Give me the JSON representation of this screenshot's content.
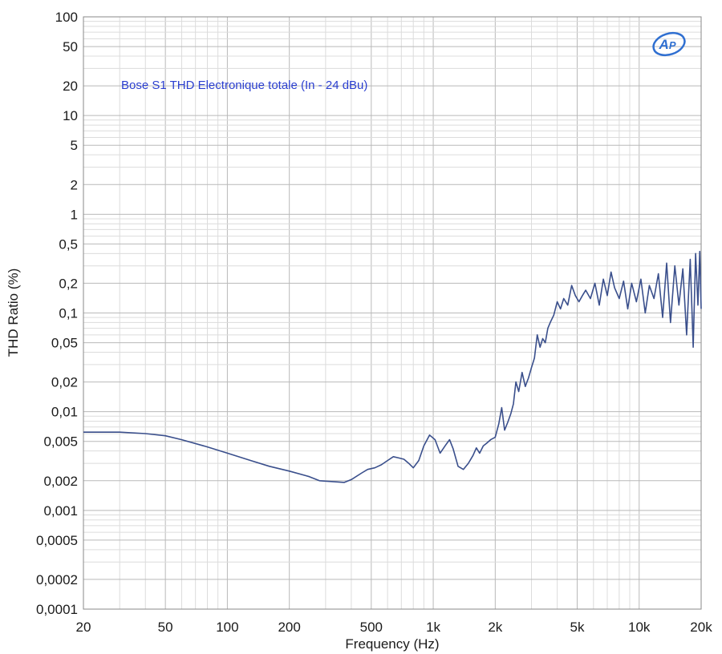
{
  "chart_data": {
    "type": "line",
    "annotation": "Bose S1 THD Electronique totale (In - 24 dBu)",
    "xlabel": "Frequency (Hz)",
    "ylabel": "THD Ratio (%)",
    "xscale": "log",
    "yscale": "log",
    "xlim": [
      20,
      20000
    ],
    "ylim": [
      0.0001,
      100
    ],
    "grid": true,
    "x_ticks": [
      {
        "value": 20,
        "label": "20"
      },
      {
        "value": 50,
        "label": "50"
      },
      {
        "value": 100,
        "label": "100"
      },
      {
        "value": 200,
        "label": "200"
      },
      {
        "value": 500,
        "label": "500"
      },
      {
        "value": 1000,
        "label": "1k"
      },
      {
        "value": 2000,
        "label": "2k"
      },
      {
        "value": 5000,
        "label": "5k"
      },
      {
        "value": 10000,
        "label": "10k"
      },
      {
        "value": 20000,
        "label": "20k"
      }
    ],
    "y_ticks": [
      {
        "value": 100,
        "label": "100"
      },
      {
        "value": 50,
        "label": "50"
      },
      {
        "value": 20,
        "label": "20"
      },
      {
        "value": 10,
        "label": "10"
      },
      {
        "value": 5,
        "label": "5"
      },
      {
        "value": 2,
        "label": "2"
      },
      {
        "value": 1,
        "label": "1"
      },
      {
        "value": 0.5,
        "label": "0,5"
      },
      {
        "value": 0.2,
        "label": "0,2"
      },
      {
        "value": 0.1,
        "label": "0,1"
      },
      {
        "value": 0.05,
        "label": "0,05"
      },
      {
        "value": 0.02,
        "label": "0,02"
      },
      {
        "value": 0.01,
        "label": "0,01"
      },
      {
        "value": 0.005,
        "label": "0,005"
      },
      {
        "value": 0.002,
        "label": "0,002"
      },
      {
        "value": 0.001,
        "label": "0,001"
      },
      {
        "value": 0.0005,
        "label": "0,0005"
      },
      {
        "value": 0.0002,
        "label": "0,0002"
      },
      {
        "value": 0.0001,
        "label": "0,0001"
      }
    ],
    "series": [
      {
        "color": "#3a4f8c",
        "points": [
          [
            20,
            0.0062
          ],
          [
            30,
            0.0062
          ],
          [
            40,
            0.006
          ],
          [
            50,
            0.0057
          ],
          [
            60,
            0.0052
          ],
          [
            80,
            0.0044
          ],
          [
            100,
            0.0038
          ],
          [
            130,
            0.0032
          ],
          [
            160,
            0.0028
          ],
          [
            200,
            0.0025
          ],
          [
            250,
            0.0022
          ],
          [
            280,
            0.002
          ],
          [
            320,
            0.00196
          ],
          [
            370,
            0.00192
          ],
          [
            400,
            0.00205
          ],
          [
            450,
            0.0024
          ],
          [
            480,
            0.0026
          ],
          [
            520,
            0.0027
          ],
          [
            560,
            0.0029
          ],
          [
            600,
            0.0032
          ],
          [
            640,
            0.0035
          ],
          [
            680,
            0.0034
          ],
          [
            720,
            0.0033
          ],
          [
            760,
            0.003
          ],
          [
            800,
            0.0027
          ],
          [
            850,
            0.0032
          ],
          [
            900,
            0.0045
          ],
          [
            960,
            0.0058
          ],
          [
            1020,
            0.0052
          ],
          [
            1080,
            0.0038
          ],
          [
            1150,
            0.0046
          ],
          [
            1200,
            0.0052
          ],
          [
            1250,
            0.0042
          ],
          [
            1320,
            0.0028
          ],
          [
            1400,
            0.0026
          ],
          [
            1480,
            0.003
          ],
          [
            1560,
            0.0036
          ],
          [
            1620,
            0.0043
          ],
          [
            1680,
            0.0038
          ],
          [
            1750,
            0.0045
          ],
          [
            1820,
            0.0048
          ],
          [
            1900,
            0.0052
          ],
          [
            2000,
            0.0055
          ],
          [
            2080,
            0.0075
          ],
          [
            2150,
            0.011
          ],
          [
            2220,
            0.0065
          ],
          [
            2300,
            0.0078
          ],
          [
            2380,
            0.0095
          ],
          [
            2450,
            0.012
          ],
          [
            2520,
            0.02
          ],
          [
            2600,
            0.016
          ],
          [
            2700,
            0.025
          ],
          [
            2800,
            0.018
          ],
          [
            2900,
            0.022
          ],
          [
            3000,
            0.028
          ],
          [
            3100,
            0.035
          ],
          [
            3200,
            0.06
          ],
          [
            3300,
            0.045
          ],
          [
            3400,
            0.055
          ],
          [
            3500,
            0.05
          ],
          [
            3600,
            0.07
          ],
          [
            3700,
            0.08
          ],
          [
            3850,
            0.095
          ],
          [
            4000,
            0.13
          ],
          [
            4150,
            0.11
          ],
          [
            4300,
            0.14
          ],
          [
            4500,
            0.12
          ],
          [
            4700,
            0.19
          ],
          [
            4900,
            0.15
          ],
          [
            5100,
            0.13
          ],
          [
            5300,
            0.15
          ],
          [
            5500,
            0.17
          ],
          [
            5800,
            0.14
          ],
          [
            6100,
            0.2
          ],
          [
            6400,
            0.12
          ],
          [
            6700,
            0.22
          ],
          [
            7000,
            0.15
          ],
          [
            7300,
            0.26
          ],
          [
            7600,
            0.18
          ],
          [
            8000,
            0.14
          ],
          [
            8400,
            0.21
          ],
          [
            8800,
            0.11
          ],
          [
            9200,
            0.2
          ],
          [
            9700,
            0.13
          ],
          [
            10200,
            0.22
          ],
          [
            10700,
            0.1
          ],
          [
            11200,
            0.19
          ],
          [
            11800,
            0.14
          ],
          [
            12400,
            0.25
          ],
          [
            13000,
            0.09
          ],
          [
            13600,
            0.32
          ],
          [
            14200,
            0.08
          ],
          [
            14900,
            0.3
          ],
          [
            15600,
            0.12
          ],
          [
            16300,
            0.28
          ],
          [
            17000,
            0.06
          ],
          [
            17700,
            0.35
          ],
          [
            18300,
            0.045
          ],
          [
            18800,
            0.4
          ],
          [
            19300,
            0.12
          ],
          [
            19700,
            0.42
          ],
          [
            20000,
            0.11
          ]
        ]
      }
    ]
  },
  "logo": {
    "text": "AP"
  }
}
